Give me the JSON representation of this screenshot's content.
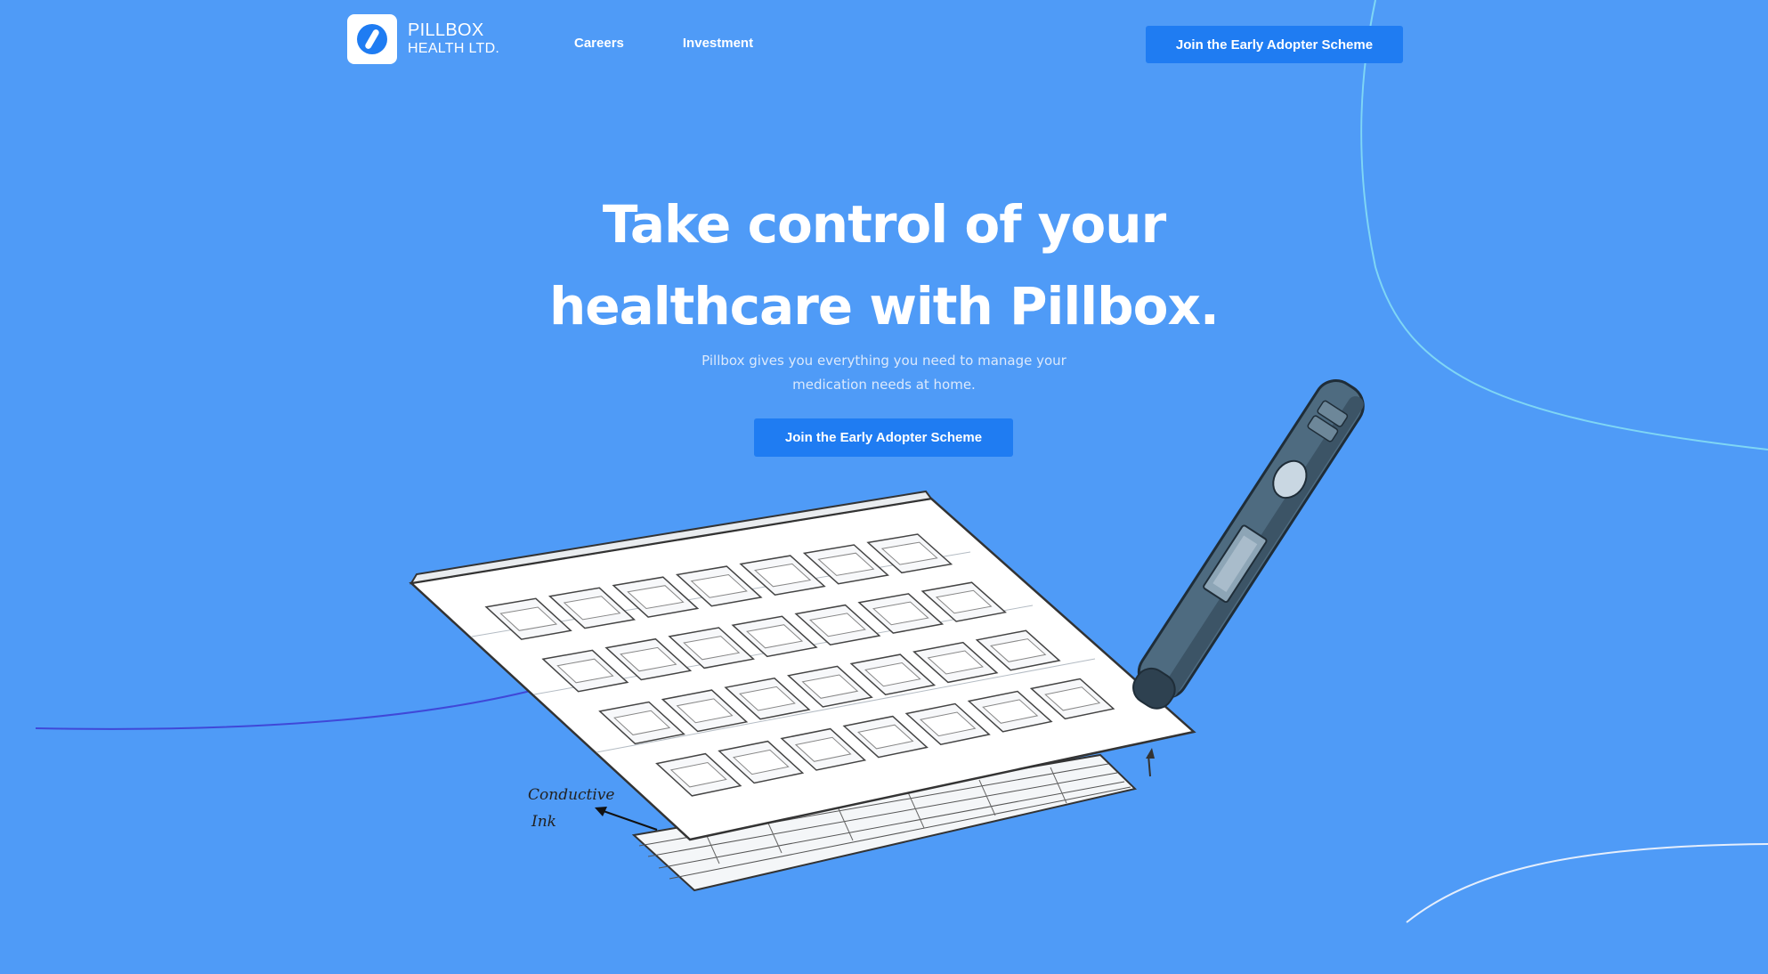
{
  "colors": {
    "background": "#4f9bf7",
    "button": "#1f7cf2",
    "text": "#ffffff"
  },
  "header": {
    "logo_icon": "pill-icon",
    "logo_line1": "PILLBOX",
    "logo_line2": "HEALTH LTD.",
    "nav": [
      {
        "label": "Careers"
      },
      {
        "label": "Investment"
      }
    ],
    "cta_label": "Join the Early Adopter Scheme"
  },
  "hero": {
    "title_line1": "Take control of your",
    "title_line2": "healthcare with Pillbox.",
    "subtitle_line1": "Pillbox gives you everything you need to manage your",
    "subtitle_line2": "medication needs at home.",
    "cta_label": "Join the Early Adopter Scheme"
  },
  "illustration": {
    "annotation_line1": "Conductive",
    "annotation_line2": "Ink"
  }
}
